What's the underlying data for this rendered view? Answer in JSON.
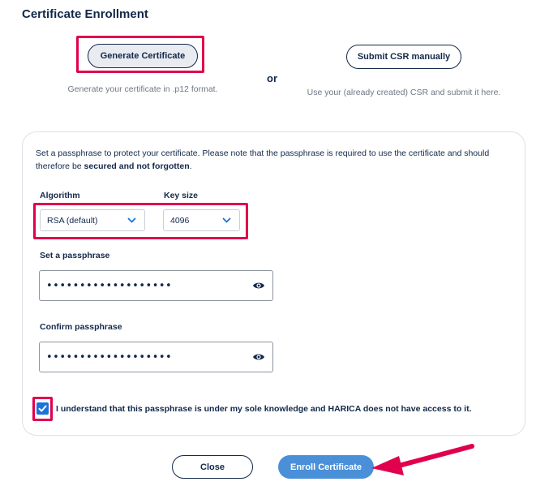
{
  "page": {
    "title": "Certificate Enrollment"
  },
  "options": {
    "generate_label": "Generate Certificate",
    "generate_desc": "Generate your certificate in .p12 format.",
    "or_text": "or",
    "csr_label": "Submit CSR manually",
    "csr_desc": "Use your (already created) CSR and submit it here."
  },
  "form": {
    "intro_text": "Set a passphrase to protect your certificate. Please note that the passphrase is required to use the certificate and should therefore be ",
    "intro_bold": "secured and not forgotten",
    "intro_end": ".",
    "algorithm_label": "Algorithm",
    "algorithm_value": "RSA (default)",
    "key_size_label": "Key size",
    "key_size_value": "4096",
    "passphrase_label": "Set a passphrase",
    "passphrase_mask": "•••••••••••••••••••",
    "confirm_label": "Confirm passphrase",
    "confirm_mask": "•••••••••••••••••••",
    "checkbox_checked": true,
    "checkbox_label": "I understand that this passphrase is under my sole knowledge and HARICA does not have access to it."
  },
  "actions": {
    "close_label": "Close",
    "enroll_label": "Enroll Certificate"
  },
  "colors": {
    "highlight": "#e0004d",
    "primary": "#4a90d9",
    "navy": "#12284a",
    "checkbox": "#1a73d9"
  },
  "icons": {
    "select_chevron": "chevron-down-icon",
    "reveal": "eye-icon",
    "check": "check-icon",
    "annotation_arrow": "arrow-left-icon"
  }
}
